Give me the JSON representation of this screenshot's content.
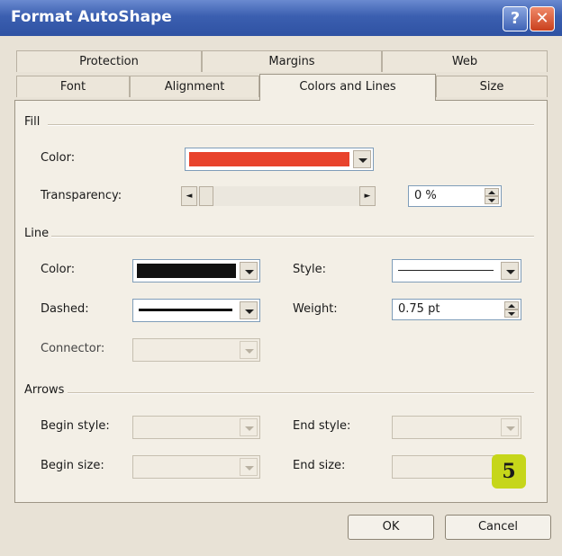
{
  "window": {
    "title": "Format AutoShape",
    "help_icon": "?",
    "close_icon": "✕"
  },
  "tabs_row1": [
    "Protection",
    "Margins",
    "Web"
  ],
  "tabs_row2": [
    "Font",
    "Alignment",
    "Colors and Lines",
    "Size"
  ],
  "active_tab": "Colors and Lines",
  "fill": {
    "section_label": "Fill",
    "color_label": "Color:",
    "color_value": "#e8432c",
    "transparency_label": "Transparency:",
    "transparency_value": "0 %",
    "slider_left_icon": "◄",
    "slider_right_icon": "►"
  },
  "line": {
    "section_label": "Line",
    "color_label": "Color:",
    "color_value": "#111111",
    "style_label": "Style:",
    "dashed_label": "Dashed:",
    "weight_label": "Weight:",
    "weight_value": "0.75 pt",
    "connector_label": "Connector:"
  },
  "arrows": {
    "section_label": "Arrows",
    "begin_style_label": "Begin style:",
    "end_style_label": "End style:",
    "begin_size_label": "Begin size:",
    "end_size_label": "End size:"
  },
  "buttons": {
    "ok": "OK",
    "cancel": "Cancel"
  },
  "badge": "5"
}
